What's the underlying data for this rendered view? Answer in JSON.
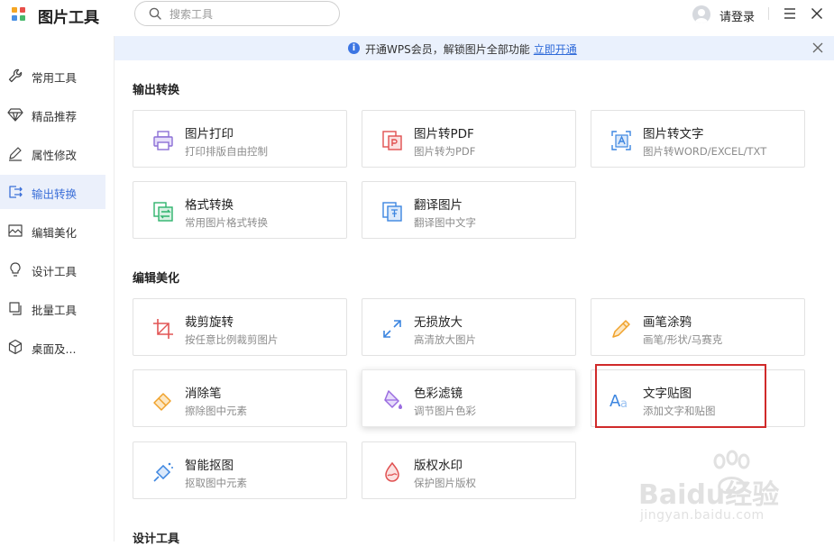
{
  "app": {
    "title": "图片工具",
    "logo_colors": [
      "#f5a623",
      "#e8504a",
      "#4a90e2",
      "#47b96c"
    ]
  },
  "search": {
    "placeholder": "搜索工具"
  },
  "user": {
    "login_label": "请登录"
  },
  "sidebar": {
    "items": [
      {
        "label": "常用工具",
        "icon": "wrench-icon"
      },
      {
        "label": "精品推荐",
        "icon": "diamond-icon"
      },
      {
        "label": "属性修改",
        "icon": "pencil-icon"
      },
      {
        "label": "输出转换",
        "icon": "convert-icon",
        "active": true
      },
      {
        "label": "编辑美化",
        "icon": "image-edit-icon"
      },
      {
        "label": "设计工具",
        "icon": "lightbulb-icon"
      },
      {
        "label": "批量工具",
        "icon": "stack-icon"
      },
      {
        "label": "桌面及...",
        "icon": "cube-icon"
      }
    ]
  },
  "banner": {
    "message": "开通WPS会员，解锁图片全部功能",
    "link": "立即开通"
  },
  "sections": [
    {
      "title": "输出转换",
      "cards": [
        {
          "title": "图片打印",
          "desc": "打印排版自由控制",
          "icon": "printer-icon"
        },
        {
          "title": "图片转PDF",
          "desc": "图片转为PDF",
          "icon": "pdf-icon"
        },
        {
          "title": "图片转文字",
          "desc": "图片转WORD/EXCEL/TXT",
          "icon": "ocr-icon"
        },
        {
          "title": "格式转换",
          "desc": "常用图片格式转换",
          "icon": "format-convert-icon"
        },
        {
          "title": "翻译图片",
          "desc": "翻译图中文字",
          "icon": "translate-icon"
        }
      ]
    },
    {
      "title": "编辑美化",
      "cards": [
        {
          "title": "裁剪旋转",
          "desc": "按任意比例裁剪图片",
          "icon": "crop-icon"
        },
        {
          "title": "无损放大",
          "desc": "高清放大图片",
          "icon": "enlarge-icon"
        },
        {
          "title": "画笔涂鸦",
          "desc": "画笔/形状/马赛克",
          "icon": "brush-icon"
        },
        {
          "title": "消除笔",
          "desc": "擦除图中元素",
          "icon": "eraser-icon"
        },
        {
          "title": "色彩滤镜",
          "desc": "调节图片色彩",
          "icon": "color-filter-icon"
        },
        {
          "title": "文字贴图",
          "desc": "添加文字和贴图",
          "icon": "text-sticker-icon"
        },
        {
          "title": "智能抠图",
          "desc": "抠取图中元素",
          "icon": "smart-cutout-icon"
        },
        {
          "title": "版权水印",
          "desc": "保护图片版权",
          "icon": "watermark-icon"
        }
      ]
    },
    {
      "title": "设计工具"
    }
  ],
  "watermark": {
    "text": "Baidu经验",
    "subtext": "jingyan.baidu.com"
  }
}
